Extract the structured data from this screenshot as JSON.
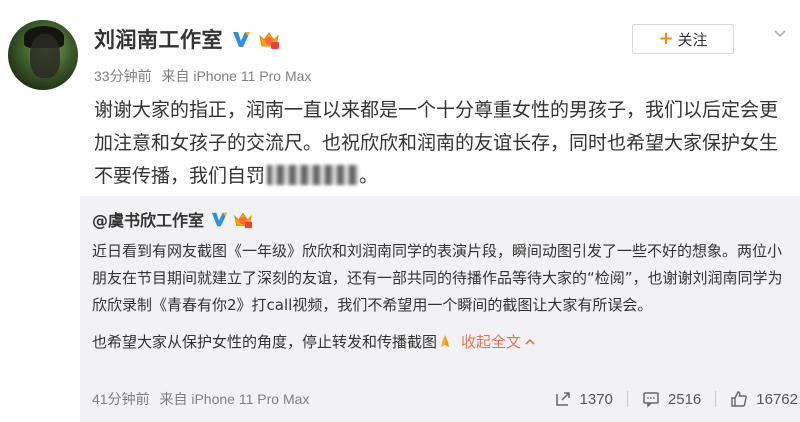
{
  "post": {
    "author": "刘润南工作室",
    "time": "33分钟前",
    "source": "来自 iPhone 11 Pro Max",
    "follow_label": "关注",
    "follow_plus": "+",
    "text_before_blur": "谢谢大家的指正，润南一直以来都是一个十分尊重女性的男孩子，我们以后定会更加注意和女孩子的交流尺。也祝欣欣和润南的友谊长存，同时也希望大家保护女生不要传播，我们自罚",
    "text_after_blur": "。"
  },
  "repost": {
    "author": "@虞书欣工作室",
    "paragraph1": "近日看到有网友截图《一年级》欣欣和刘润南同学的表演片段，瞬间动图引发了一些不好的想象。两位小朋友在节目期间就建立了深刻的友谊，还有一部共同的待播作品等待大家的“检阅”，也谢谢刘润南同学为欣欣录制《青春有你2》打call视频，我们不希望用一个瞬间的截图让大家有所误会。",
    "paragraph2": "也希望大家从保护女性的角度，停止转发和传播截图",
    "collapse_label": "收起全文",
    "time": "41分钟前",
    "source": "来自 iPhone 11 Pro Max",
    "repost_count": "1370",
    "comment_count": "2516",
    "like_count": "16762"
  },
  "colors": {
    "accent_orange": "#ff8200",
    "link_orange": "#eb7350",
    "verify_blue": "#2f8fe3",
    "repost_bg": "#f2f2f5"
  },
  "icons": {
    "verify": "verified-v-icon",
    "vip": "vip-crown-icon",
    "menu": "chevron-down-icon",
    "repost": "repost-icon",
    "comment": "comment-icon",
    "like": "thumbs-up-icon",
    "pray": "pray-emoji-icon",
    "collapse": "chevron-up-icon"
  }
}
